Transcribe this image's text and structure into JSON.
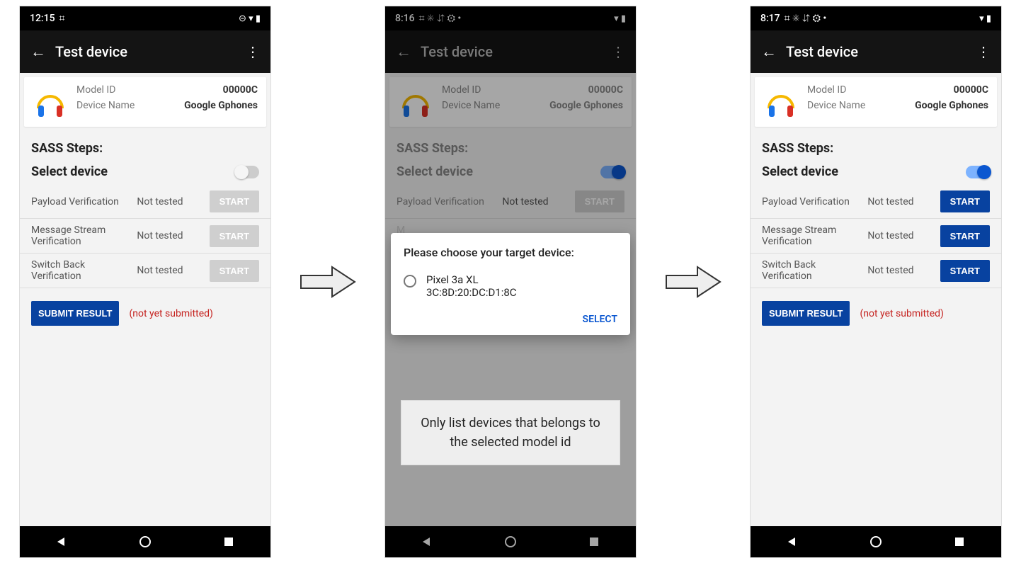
{
  "statusbars": [
    {
      "time": "12:15",
      "left_icons": "⌗",
      "right_icons": "⊝ ▾ ▮"
    },
    {
      "time": "8:16",
      "left_icons": "⌗ ✳ ⇵ ⚙ •",
      "right_icons": "▾ ▮"
    },
    {
      "time": "8:17",
      "left_icons": "⌗ ✳ ⇵ ⚙ •",
      "right_icons": "▾ ▮"
    }
  ],
  "appbar": {
    "title": "Test device"
  },
  "device_card": {
    "model_id_label": "Model ID",
    "model_id_value": "00000C",
    "device_name_label": "Device Name",
    "device_name_value": "Google Gphones"
  },
  "sections": {
    "sass_title": "SASS Steps:",
    "select_device": "Select device"
  },
  "steps": [
    {
      "name": "Payload Verification",
      "status": "Not tested",
      "action": "START"
    },
    {
      "name": "Message Stream Verification",
      "status": "Not tested",
      "action": "START"
    },
    {
      "name": "Switch Back Verification",
      "status": "Not tested",
      "action": "START"
    }
  ],
  "submit": {
    "label": "SUBMIT RESULT",
    "hint": "(not yet submitted)"
  },
  "dialog": {
    "title": "Please choose your target device:",
    "device_name": "Pixel 3a XL",
    "device_mac": "3C:8D:20:DC:D1:8C",
    "action": "SELECT"
  },
  "caption": "Only list devices that belongs to the selected model id",
  "phone1": {
    "toggle_on": false,
    "buttons_enabled": false
  },
  "phone2": {
    "toggle_on": true,
    "buttons_enabled": true
  },
  "phone3": {
    "toggle_on": true,
    "buttons_enabled": true
  }
}
